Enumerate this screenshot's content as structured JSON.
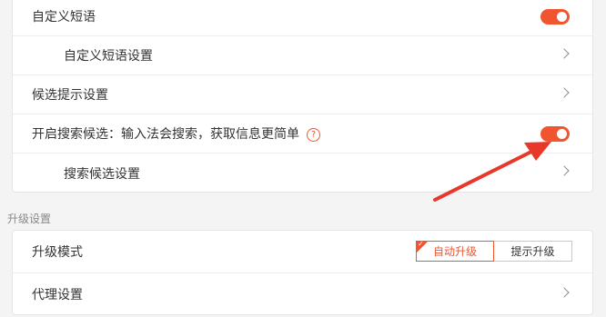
{
  "candidates": {
    "rows": [
      {
        "label": "自定义短语"
      },
      {
        "label": "自定义短语设置"
      },
      {
        "label": "候选提示设置"
      },
      {
        "label": "开启搜索候选：输入法会搜索，获取信息更简单"
      },
      {
        "label": "搜索候选设置"
      }
    ],
    "help_glyph": "?"
  },
  "upgrade": {
    "section_title": "升级设置",
    "mode_label": "升级模式",
    "options": [
      "自动升级",
      "提示升级"
    ],
    "selected": "自动升级",
    "proxy_label": "代理设置"
  },
  "toggles": {
    "custom_phrase": true,
    "search_candidates": true
  },
  "colors": {
    "accent": "#f0552f",
    "annotation_arrow": "#e8382a"
  }
}
